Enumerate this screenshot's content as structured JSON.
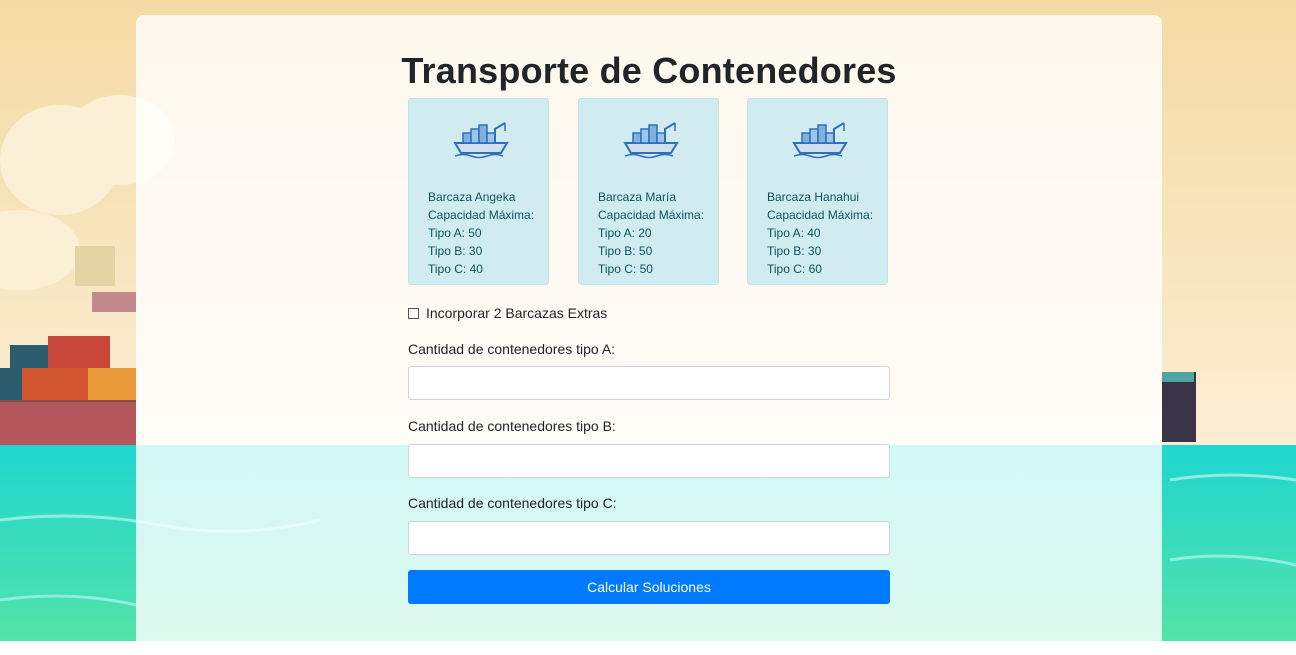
{
  "page": {
    "title": "Transporte de Contenedores"
  },
  "barges": [
    {
      "name": "Barcaza Angeka",
      "capacity_label": "Capacidad Máxima:",
      "tipo_a": "Tipo A: 50",
      "tipo_b": "Tipo B: 30",
      "tipo_c": "Tipo C: 40"
    },
    {
      "name": "Barcaza María",
      "capacity_label": "Capacidad Máxima:",
      "tipo_a": "Tipo A: 20",
      "tipo_b": "Tipo B: 50",
      "tipo_c": "Tipo C: 50"
    },
    {
      "name": "Barcaza Hanahui",
      "capacity_label": "Capacidad Máxima:",
      "tipo_a": "Tipo A: 40",
      "tipo_b": "Tipo B: 30",
      "tipo_c": "Tipo C: 60"
    }
  ],
  "extras": {
    "label": "Incorporar 2 Barcazas Extras",
    "checked": false
  },
  "form": {
    "field_a_label": "Cantidad de contenedores tipo A:",
    "field_a_value": "",
    "field_b_label": "Cantidad de contenedores tipo B:",
    "field_b_value": "",
    "field_c_label": "Cantidad de contenedores tipo C:",
    "field_c_value": "",
    "submit_label": "Calcular Soluciones"
  },
  "colors": {
    "card_bg": "#d1ecf1",
    "card_text": "#0c5460",
    "button": "#007bff",
    "sea": "#27d3c0",
    "sky": "#f4dba4"
  },
  "icons": {
    "barge": "cargo-ship-icon"
  }
}
